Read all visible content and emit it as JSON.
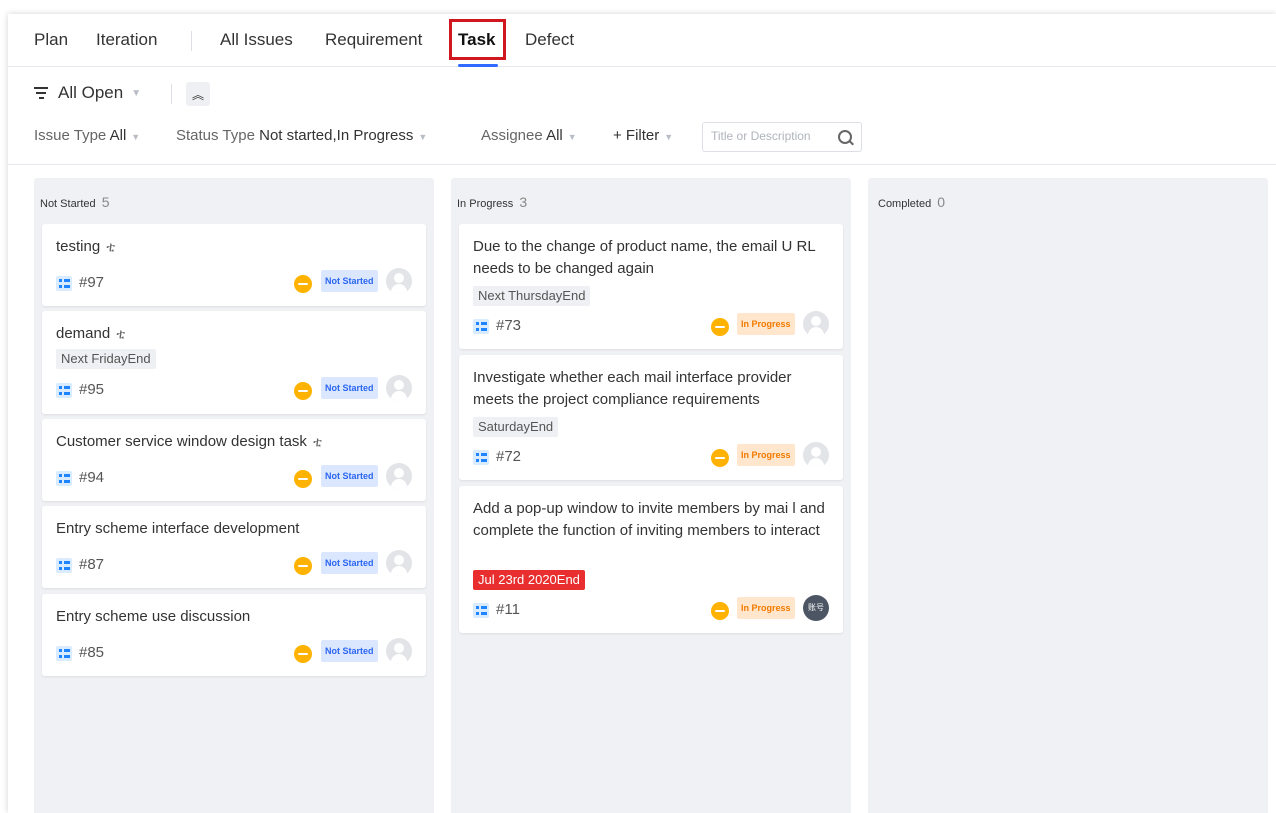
{
  "tabs": [
    "Plan",
    "Iteration",
    "All Issues",
    "Requirement",
    "Task",
    "Defect"
  ],
  "active_tab": "Task",
  "view": {
    "label": "All Open",
    "collapse_icon": "double-chevron-up-icon"
  },
  "filters": {
    "issue_type_label": "Issue Type",
    "issue_type_value": "All",
    "status_type_label": "Status Type",
    "status_type_value": "Not started,In Progress",
    "assignee_label": "Assignee",
    "assignee_value": "All",
    "add_filter": "+ Filter",
    "search_placeholder": "Title or Description"
  },
  "columns": [
    {
      "title": "Not Started",
      "count": "5",
      "cards": [
        {
          "title": "testing",
          "subtasks": true,
          "id": "#97",
          "status": "Not Started"
        },
        {
          "title": "demand",
          "subtasks": true,
          "due": "Next FridayEnd",
          "id": "#95",
          "status": "Not Started"
        },
        {
          "title": "Customer service window design task",
          "subtasks": true,
          "id": "#94",
          "status": "Not Started"
        },
        {
          "title": "Entry scheme interface development",
          "id": "#87",
          "status": "Not Started"
        },
        {
          "title": "Entry scheme use discussion",
          "id": "#85",
          "status": "Not Started"
        }
      ]
    },
    {
      "title": "In Progress",
      "count": "3",
      "cards": [
        {
          "title": "Due to the change of product name, the email U RL needs to be changed again",
          "due": "Next ThursdayEnd",
          "id": "#73",
          "status": "In Progress"
        },
        {
          "title": "Investigate whether each mail interface provider meets the project compliance requirements",
          "due": "SaturdayEnd",
          "id": "#72",
          "status": "In Progress"
        },
        {
          "title": "Add a pop-up window to invite members by mai l and complete the function of inviting members to interact",
          "due": "Jul 23rd 2020End",
          "due_color": "#e82e2e",
          "id": "#11",
          "status": "In Progress",
          "avatar_text": "账号"
        }
      ]
    },
    {
      "title": "Completed",
      "count": "0",
      "cards": []
    }
  ],
  "colors": {
    "accent": "#2f6bff",
    "highlight": "#d0161f",
    "priority": "#ffb300",
    "not_started_bg": "#dbe7ff",
    "in_progress_bg": "#ffe6cc",
    "overdue": "#e82e2e"
  }
}
